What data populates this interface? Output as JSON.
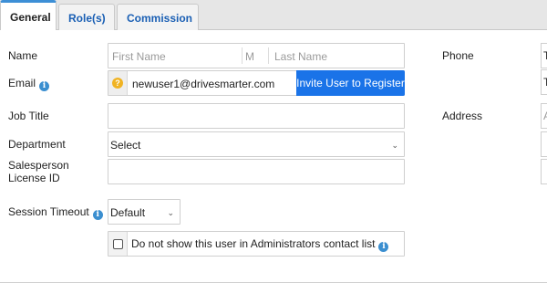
{
  "tabs": [
    {
      "label": "General",
      "active": true
    },
    {
      "label": "Role(s)",
      "active": false
    },
    {
      "label": "Commission",
      "active": false
    }
  ],
  "form": {
    "name_label": "Name",
    "first_name_placeholder": "First Name",
    "middle_placeholder": "M",
    "last_name_placeholder": "Last Name",
    "email_label": "Email",
    "email_value": "newuser1@drivesmarter.com",
    "invite_button": "Invite User to Register",
    "job_title_label": "Job Title",
    "department_label": "Department",
    "department_value": "Select",
    "salesperson_label_line1": "Salesperson",
    "salesperson_label_line2": "License ID",
    "session_timeout_label": "Session Timeout",
    "session_timeout_value": "Default",
    "hide_contact_label": "Do not show this user in Administrators contact list",
    "phone_label": "Phone",
    "address_label": "Address",
    "phone_edge_1": "T",
    "phone_edge_2": "T",
    "address_edge": "A"
  },
  "icons": {
    "info": "info-icon",
    "question": "question-icon",
    "chevron": "chevron-down-icon"
  },
  "colors": {
    "accent": "#1a73e8",
    "tab_link": "#1a5fb4",
    "info_icon": "#3b8fd0",
    "warning_icon": "#f0b323"
  }
}
